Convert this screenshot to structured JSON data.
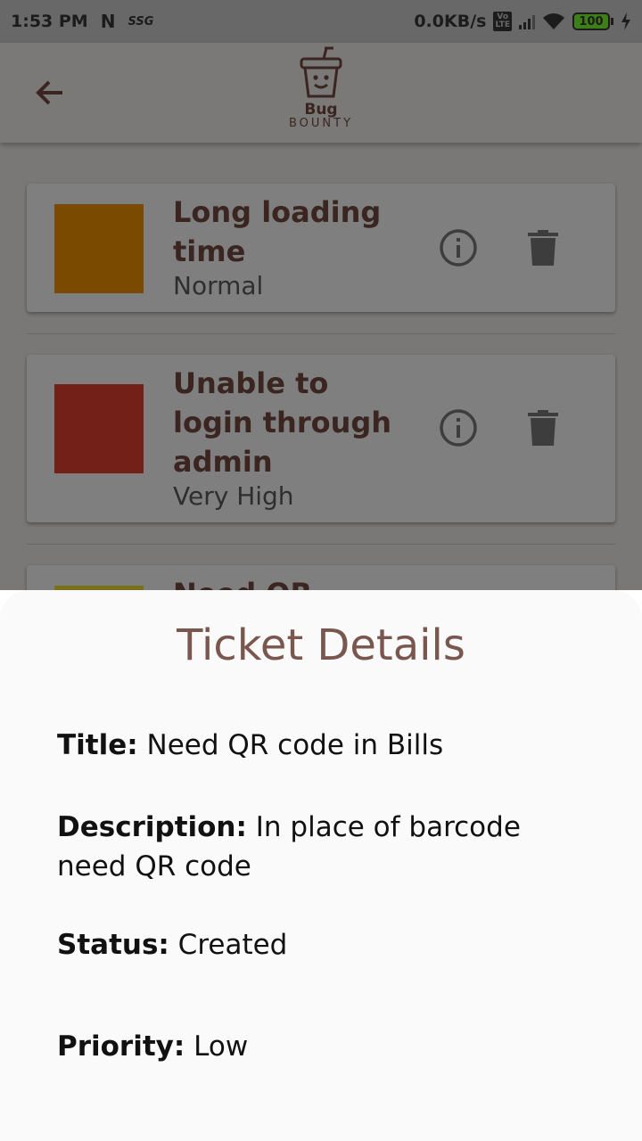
{
  "status_bar": {
    "time": "1:53 PM",
    "carrier_n": "N",
    "carrier_ssg": "SSG",
    "network_speed": "0.0KB/s",
    "volte": "Vo LTE",
    "battery": "100"
  },
  "app_bar": {
    "logo_line1": "Bug",
    "logo_line2": "BOUNTY",
    "icons": [
      "back-arrow",
      "cup-smiley-logo"
    ]
  },
  "tickets": [
    {
      "title": "Long loading time",
      "priority": "Normal",
      "color": "#7a4a00"
    },
    {
      "title": "Unable to login through admin",
      "priority": "Very High",
      "color": "#732019"
    },
    {
      "title": "Need QR",
      "priority": "Low",
      "color": "#7c6f1a"
    }
  ],
  "sheet": {
    "title": "Ticket Details",
    "title_label": "Title:",
    "title_value": "Need QR code in Bills",
    "description_label": "Description:",
    "description_value": "In place of barcode need QR code",
    "status_label": "Status:",
    "status_value": "Created",
    "priority_label": "Priority:",
    "priority_value": "Low"
  },
  "colors": {
    "accent_brown": "#79574f",
    "scrim": "#7a7876",
    "sheet_bg": "#fafafa"
  }
}
